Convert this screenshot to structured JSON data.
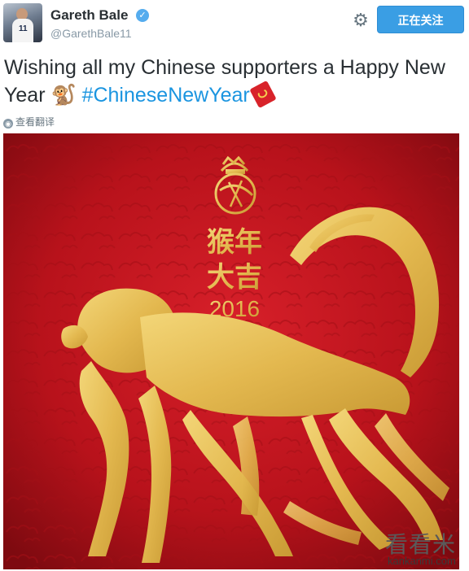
{
  "tweet": {
    "author_name": "Gareth Bale",
    "handle": "@GarethBale11",
    "follow_label": "正在关注",
    "text_before": "Wishing all my Chinese supporters a Happy New Year ",
    "monkey_emoji": "🐒",
    "hashtag": "#ChineseNewYear",
    "translate_label": "查看翻译"
  },
  "poster": {
    "line1": "猴年",
    "line2": "大吉",
    "year": "2016"
  },
  "watermark": {
    "cn": "看看米",
    "url": "kankanmi.com"
  },
  "colors": {
    "follow_blue": "#3a9ee4",
    "hashtag_blue": "#1b95e0",
    "poster_red": "#c8161d",
    "poster_gold": "#e6bf5a"
  },
  "icons": [
    "verified-badge-icon",
    "gear-icon",
    "globe-icon",
    "red-envelope-icon",
    "real-madrid-crest"
  ]
}
